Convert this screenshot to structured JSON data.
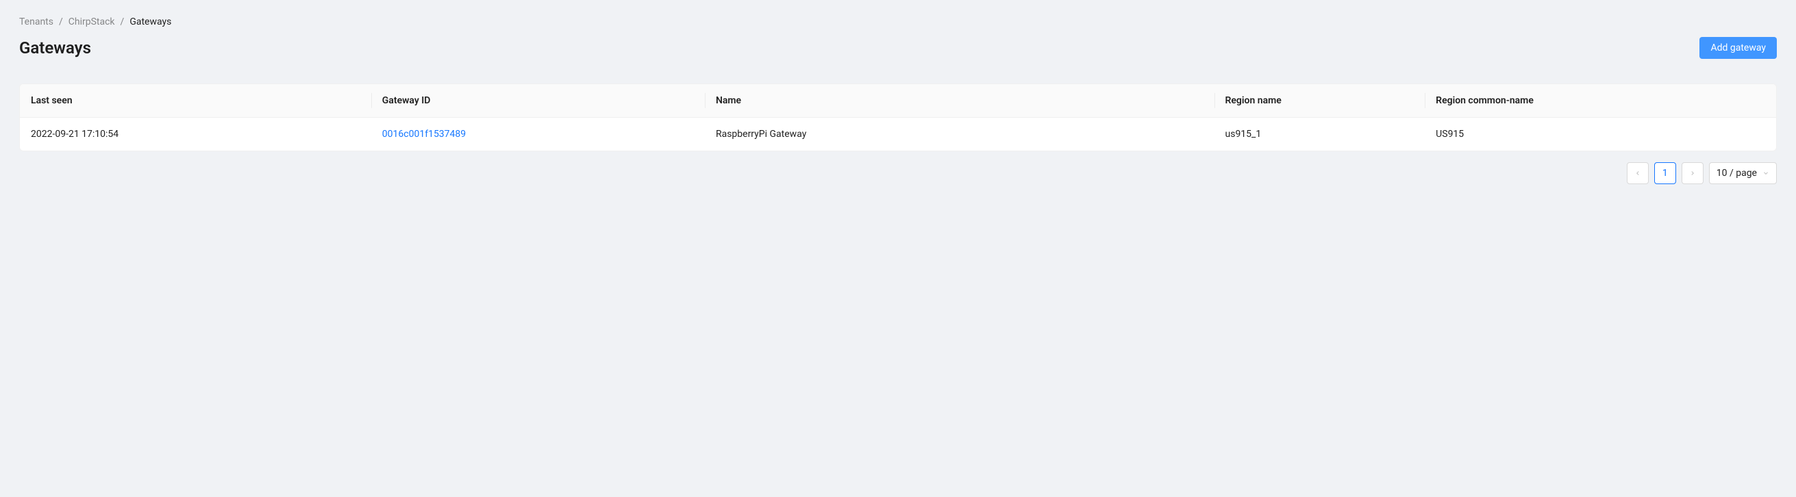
{
  "breadcrumb": {
    "items": [
      "Tenants",
      "ChirpStack",
      "Gateways"
    ],
    "sep": "/"
  },
  "header": {
    "title": "Gateways",
    "add_button_label": "Add gateway"
  },
  "table": {
    "columns": {
      "last_seen": "Last seen",
      "gateway_id": "Gateway ID",
      "name": "Name",
      "region_name": "Region name",
      "region_common_name": "Region common-name"
    },
    "rows": [
      {
        "last_seen": "2022-09-21 17:10:54",
        "gateway_id": "0016c001f1537489",
        "name": "RaspberryPi Gateway",
        "region_name": "us915_1",
        "region_common_name": "US915"
      }
    ]
  },
  "pagination": {
    "current_page": "1",
    "page_size_label": "10 / page"
  }
}
